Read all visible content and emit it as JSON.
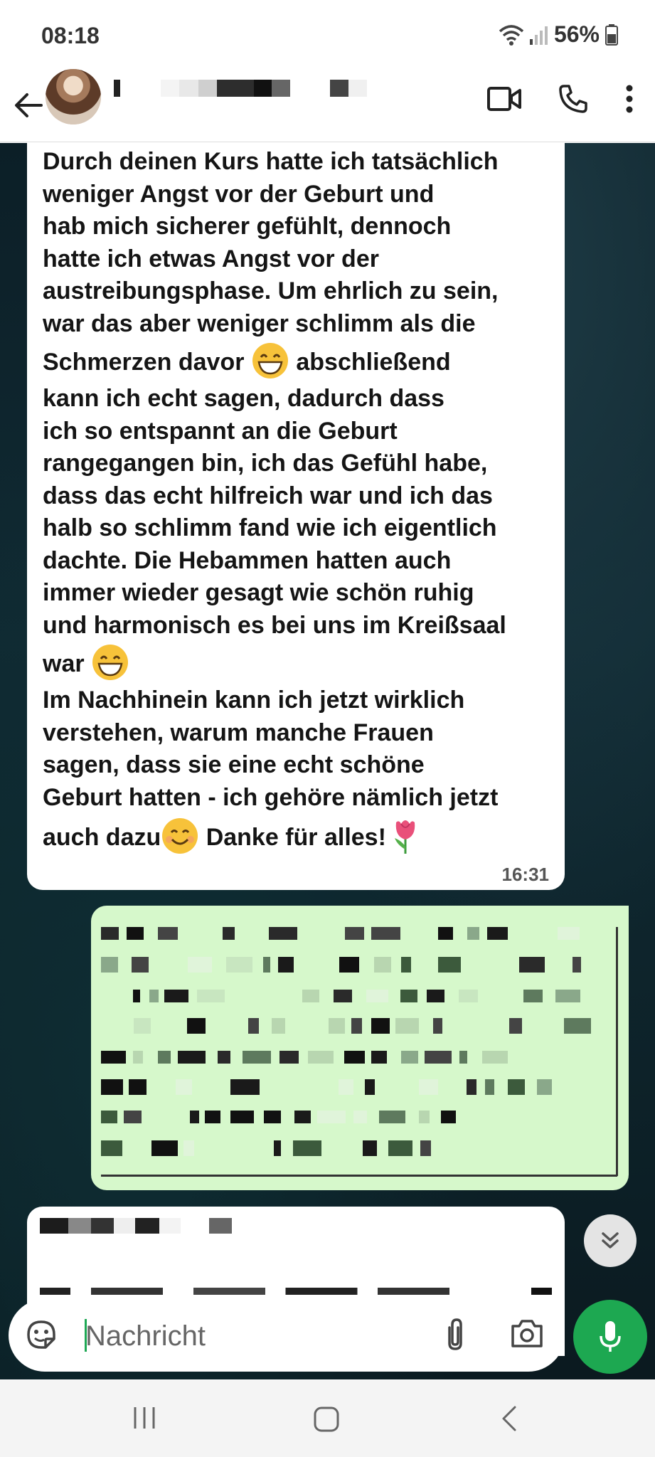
{
  "status_bar": {
    "time": "08:18",
    "battery": "56%",
    "icons": [
      "wifi-icon",
      "signal-icon",
      "battery-icon"
    ]
  },
  "app_bar": {
    "icons": [
      "back-arrow-icon",
      "video-call-icon",
      "phone-icon",
      "more-vert-icon"
    ]
  },
  "messages": {
    "incoming_1": {
      "lines": [
        "Durch deinen Kurs hatte ich tatsächlich",
        "weniger Angst vor der Geburt und",
        "hab mich sicherer gefühlt, dennoch",
        "hatte ich etwas Angst vor der",
        "austreibungsphase. Um ehrlich zu sein,",
        "war das aber weniger schlimm als die"
      ],
      "line7_a": "Schmerzen davor",
      "line7_b": " abschließend",
      "lines_2": [
        "kann ich echt sagen, dadurch dass",
        "ich so entspannt an die Geburt",
        "rangegangen bin, ich das Gefühl habe,",
        "dass das echt hilfreich war und ich das",
        "halb so schlimm fand wie ich eigentlich",
        "dachte. Die Hebammen hatten auch",
        "immer wieder gesagt wie schön ruhig",
        "und harmonisch es bei uns im Kreißsaal"
      ],
      "line_war": "war",
      "lines_3": [
        "Im Nachhinein kann ich jetzt wirklich",
        "verstehen, warum manche Frauen",
        "sagen, dass sie eine echt schöne",
        "Geburt hatten - ich gehöre nämlich jetzt"
      ],
      "last_a": "auch dazu",
      "last_b": " Danke für alles!",
      "time": "16:31"
    }
  },
  "input": {
    "placeholder": "Nachricht"
  },
  "colors": {
    "incoming_bubble": "#ffffff",
    "outgoing_bubble": "#d6f8cb",
    "accent_green": "#1da851"
  }
}
